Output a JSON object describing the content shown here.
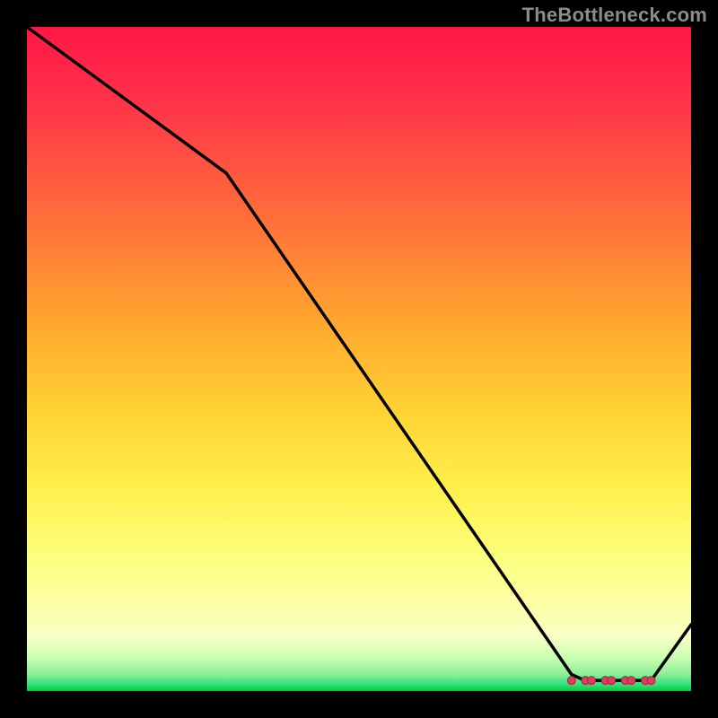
{
  "watermark": "TheBottleneck.com",
  "chart_data": {
    "type": "line",
    "title": "",
    "xlabel": "",
    "ylabel": "",
    "xlim": [
      0,
      100
    ],
    "ylim": [
      0,
      100
    ],
    "x": [
      0,
      30,
      82,
      84,
      90,
      94,
      100
    ],
    "values": [
      100,
      78,
      2.5,
      1.6,
      1.6,
      1.6,
      10
    ],
    "marker_region": {
      "from_x": 82,
      "to_x": 94,
      "y": 1.6
    },
    "gradient_stops": [
      {
        "pos": 0,
        "color": "#ff1744"
      },
      {
        "pos": 0.1,
        "color": "#ff2f49"
      },
      {
        "pos": 0.28,
        "color": "#ff6c3b"
      },
      {
        "pos": 0.44,
        "color": "#ffa52e"
      },
      {
        "pos": 0.58,
        "color": "#ffd334"
      },
      {
        "pos": 0.7,
        "color": "#fff14e"
      },
      {
        "pos": 0.8,
        "color": "#fbff7e"
      },
      {
        "pos": 0.87,
        "color": "#feffa8"
      },
      {
        "pos": 0.92,
        "color": "#f6ffc6"
      },
      {
        "pos": 0.95,
        "color": "#c8ffb0"
      },
      {
        "pos": 0.975,
        "color": "#8af098"
      },
      {
        "pos": 0.99,
        "color": "#2de27e"
      },
      {
        "pos": 1.0,
        "color": "#00cc33"
      }
    ],
    "colors": {
      "line": "#000000",
      "marker_fill": "#d9405a",
      "marker_stroke": "#a02a3d",
      "background": "#000000"
    }
  }
}
